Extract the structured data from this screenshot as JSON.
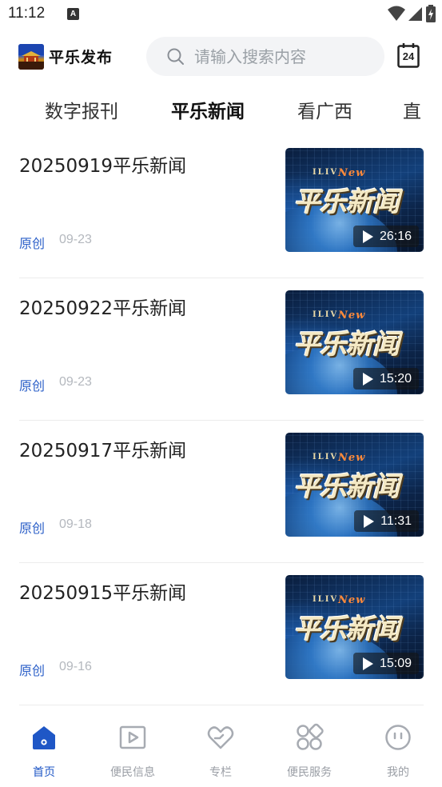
{
  "status_bar": {
    "time": "11:12",
    "a_label": "A"
  },
  "header": {
    "logo_text": "平乐发布",
    "search_placeholder": "请输入搜索内容",
    "calendar_day": "24"
  },
  "tabs": [
    {
      "label": "数字报刊",
      "active": false
    },
    {
      "label": "平乐新闻",
      "active": true
    },
    {
      "label": "看广西",
      "active": false
    },
    {
      "label": "直",
      "active": false
    }
  ],
  "news": [
    {
      "title": "20250919平乐新闻",
      "tag": "原创",
      "date": "09-23",
      "duration": "26:16",
      "thumb_title": "平乐新闻",
      "thumb_en": "ILIV",
      "thumb_news": "New"
    },
    {
      "title": "20250922平乐新闻",
      "tag": "原创",
      "date": "09-23",
      "duration": "15:20",
      "thumb_title": "平乐新闻",
      "thumb_en": "ILIV",
      "thumb_news": "New"
    },
    {
      "title": "20250917平乐新闻",
      "tag": "原创",
      "date": "09-18",
      "duration": "11:31",
      "thumb_title": "平乐新闻",
      "thumb_en": "ILIV",
      "thumb_news": "New"
    },
    {
      "title": "20250915平乐新闻",
      "tag": "原创",
      "date": "09-16",
      "duration": "15:09",
      "thumb_title": "平乐新闻",
      "thumb_en": "ILIV",
      "thumb_news": "New"
    }
  ],
  "bottom_nav": [
    {
      "label": "首页",
      "icon": "home-icon",
      "active": true
    },
    {
      "label": "便民信息",
      "icon": "video-icon",
      "active": false
    },
    {
      "label": "专栏",
      "icon": "heart-icon",
      "active": false
    },
    {
      "label": "便民服务",
      "icon": "grid-icon",
      "active": false
    },
    {
      "label": "我的",
      "icon": "profile-icon",
      "active": false
    }
  ],
  "colors": {
    "accent": "#1f57c6",
    "tag": "#2b5fc8",
    "muted": "#9a9ea5"
  }
}
